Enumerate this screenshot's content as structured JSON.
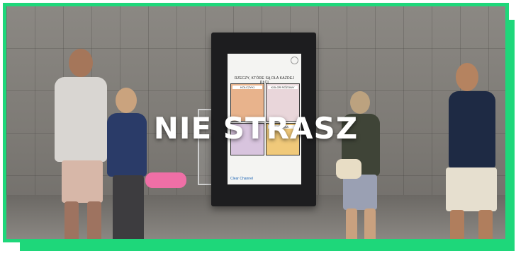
{
  "overlay": {
    "title": "NIE STRASZ"
  },
  "poster": {
    "heading": "RZECZY, KTÓRE SĄ DLA KAŻDEJ PŁCI",
    "panels": [
      "KOLCZYKI",
      "KOLOR RÓŻOWY",
      "",
      "SZTUKA"
    ],
    "brand": "Clear Channel"
  },
  "colors": {
    "accent": "#1ed77a"
  }
}
